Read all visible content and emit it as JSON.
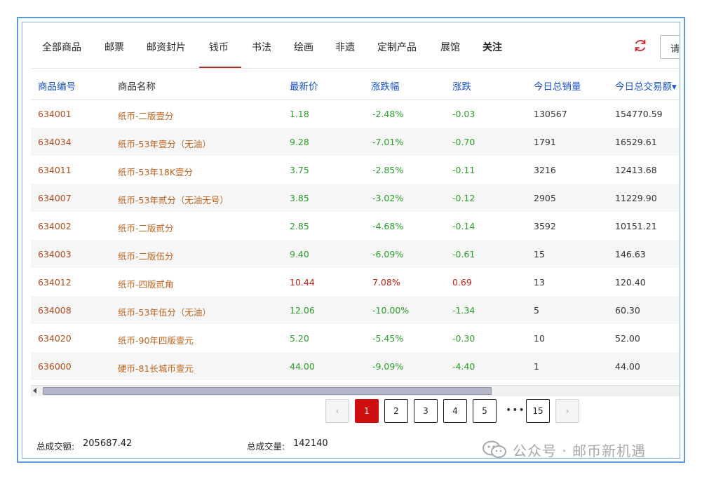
{
  "tabs": [
    {
      "label": "全部商品",
      "active": false
    },
    {
      "label": "邮票",
      "active": false
    },
    {
      "label": "邮资封片",
      "active": false
    },
    {
      "label": "钱币",
      "active": true
    },
    {
      "label": "书法",
      "active": false
    },
    {
      "label": "绘画",
      "active": false
    },
    {
      "label": "非遗",
      "active": false
    },
    {
      "label": "定制产品",
      "active": false
    },
    {
      "label": "展馆",
      "active": false
    },
    {
      "label": "关注",
      "active": false
    }
  ],
  "search": {
    "placeholder": "请"
  },
  "refresh_icon": "refresh-icon",
  "columns": [
    "商品编号",
    "商品名称",
    "最新价",
    "涨跌幅",
    "涨跌",
    "今日总销量",
    "今日总交易额▾"
  ],
  "rows": [
    {
      "code": "634001",
      "name": "纸币-二版壹分",
      "price": "1.18",
      "pct": "-2.48%",
      "chg": "-0.03",
      "qty": "130567",
      "amount": "154770.59",
      "trend": "down"
    },
    {
      "code": "634034",
      "name": "纸币-53年壹分（无油）",
      "price": "9.28",
      "pct": "-7.01%",
      "chg": "-0.70",
      "qty": "1791",
      "amount": "16529.61",
      "trend": "down"
    },
    {
      "code": "634011",
      "name": "纸币-53年18K壹分",
      "price": "3.75",
      "pct": "-2.85%",
      "chg": "-0.11",
      "qty": "3216",
      "amount": "12413.68",
      "trend": "down"
    },
    {
      "code": "634007",
      "name": "纸币-53年贰分（无油无号）",
      "price": "3.85",
      "pct": "-3.02%",
      "chg": "-0.12",
      "qty": "2905",
      "amount": "11229.90",
      "trend": "down"
    },
    {
      "code": "634002",
      "name": "纸币-二版贰分",
      "price": "2.85",
      "pct": "-4.68%",
      "chg": "-0.14",
      "qty": "3592",
      "amount": "10151.21",
      "trend": "down"
    },
    {
      "code": "634003",
      "name": "纸币-二版伍分",
      "price": "9.40",
      "pct": "-6.09%",
      "chg": "-0.61",
      "qty": "15",
      "amount": "146.63",
      "trend": "down"
    },
    {
      "code": "634012",
      "name": "纸币-四版贰角",
      "price": "10.44",
      "pct": "7.08%",
      "chg": "0.69",
      "qty": "13",
      "amount": "120.40",
      "trend": "up"
    },
    {
      "code": "634008",
      "name": "纸币-53年伍分（无油）",
      "price": "12.06",
      "pct": "-10.00%",
      "chg": "-1.34",
      "qty": "5",
      "amount": "60.30",
      "trend": "down"
    },
    {
      "code": "634020",
      "name": "纸币-90年四版壹元",
      "price": "5.20",
      "pct": "-5.45%",
      "chg": "-0.30",
      "qty": "10",
      "amount": "52.00",
      "trend": "down"
    },
    {
      "code": "636000",
      "name": "硬币-81长城币壹元",
      "price": "44.00",
      "pct": "-9.09%",
      "chg": "-4.40",
      "qty": "1",
      "amount": "44.00",
      "trend": "down"
    }
  ],
  "pagination": {
    "prev": "‹",
    "pages": [
      "1",
      "2",
      "3",
      "4",
      "5"
    ],
    "ellipsis": "•••",
    "last": "15",
    "next": "›",
    "current": "1"
  },
  "footer": {
    "total_amount_label": "总成交额:",
    "total_amount": "205687.42",
    "total_volume_label": "总成交量:",
    "total_volume": "142140"
  },
  "watermark": {
    "text": "公众号 · 邮币新机遇",
    "icon": "wechat-icon"
  },
  "colors": {
    "active_tab": "#a8322a",
    "header_link": "#1a53c5",
    "up": "#c0241b",
    "down": "#2aa12a",
    "page_active": "#cc1010",
    "frame": "#5b9bd5"
  }
}
